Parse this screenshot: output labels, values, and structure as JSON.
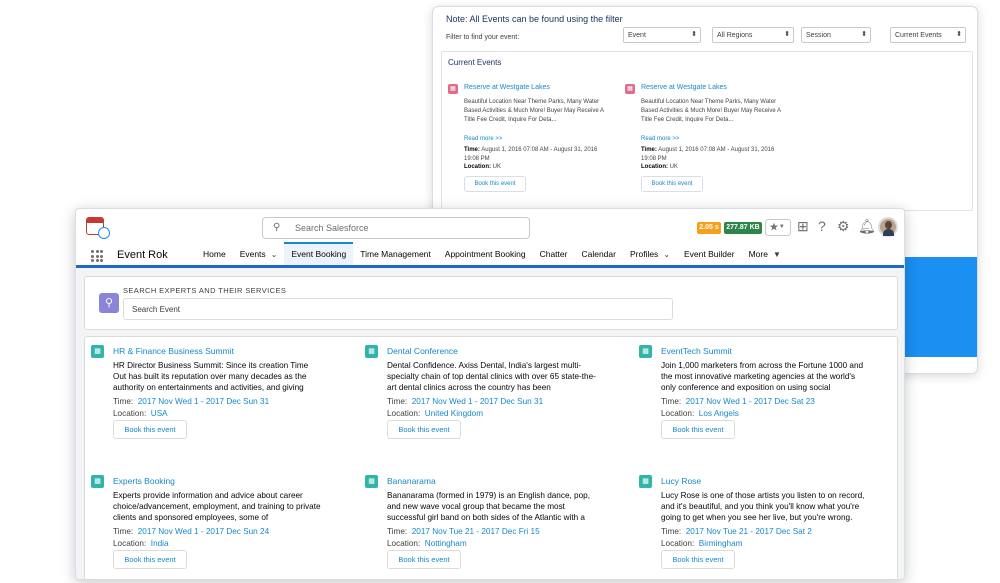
{
  "back": {
    "note": "Note: All Events can be found using the filter",
    "filter_label": "Filter to find your event:",
    "filters": [
      "Event",
      "All Regions",
      "Session",
      "Current Events"
    ],
    "panel_title": "Current Events",
    "cards": [
      {
        "title": "Reserve at Westgate Lakes",
        "desc": "Beautiful Location Near Theme Parks, Many Water Based Activities & Much More! Buyer May Receive A Title Fee Credit, Inquire For Deta...",
        "more": "Read more >>",
        "time_label": "Time:",
        "time_value": "August 1, 2016 07:08 AM - August 31, 2016 19:08 PM",
        "location_label": "Location:",
        "location_value": "UK",
        "button": "Book this event"
      },
      {
        "title": "Reserve at Westgate Lakes",
        "desc": "Beautiful Location Near Theme Parks, Many Water Based Activities & Much More! Buyer May Receive A Title Fee Credit, Inquire For Deta...",
        "more": "Read more >>",
        "time_label": "Time:",
        "time_value": "August 1, 2016 07:08 AM - August 31, 2016 19:08 PM",
        "location_label": "Location:",
        "location_value": "UK",
        "button": "Book this event"
      }
    ]
  },
  "header": {
    "search_placeholder": "Search Salesforce",
    "badge_time": "2.05 s",
    "badge_size": "277.87 KB"
  },
  "nav": {
    "app_name": "Event Rok",
    "items": [
      {
        "label": "Home",
        "dropdown": false
      },
      {
        "label": "Events",
        "dropdown": true
      },
      {
        "label": "Event Booking",
        "dropdown": false,
        "active": true
      },
      {
        "label": "Time Management",
        "dropdown": false
      },
      {
        "label": "Appointment Booking",
        "dropdown": false
      },
      {
        "label": "Chatter",
        "dropdown": false
      },
      {
        "label": "Calendar",
        "dropdown": false
      },
      {
        "label": "Profiles",
        "dropdown": true
      },
      {
        "label": "Event Builder",
        "dropdown": false
      },
      {
        "label": "More",
        "dropdown": true
      }
    ]
  },
  "search": {
    "heading": "SEARCH EXPERTS AND THEIR SERVICES",
    "placeholder": "Search Event"
  },
  "events": [
    {
      "title": "HR & Finance Business Summit",
      "desc": "HR Director Business Summit: Since its creation Time Out has built its reputation over many decades as the authority on entertainments and activities, and giving",
      "time_label": "Time:",
      "time_value": "2017 Nov Wed 1 - 2017 Dec Sun 31",
      "location_label": "Location:",
      "location_value": "USA",
      "button": "Book this event"
    },
    {
      "title": "Dental Conference",
      "desc": "Dental Confidence. Axiss Dental, India's largest multi-specialty chain of top dental clinics with over 65 state-the-art dental clinics across the country has been",
      "time_label": "Time:",
      "time_value": "2017 Nov Wed 1 - 2017 Dec Sun 31",
      "location_label": "Location:",
      "location_value": "United Kingdom",
      "button": "Book this event"
    },
    {
      "title": "EventTech Summit",
      "desc": "Join 1,000 marketers from across the Fortune 1000 and the most innovative marketing agencies at the world's only conference and exposition on using social",
      "time_label": "Time:",
      "time_value": "2017 Nov Wed 1 - 2017 Dec Sat 23",
      "location_label": "Location:",
      "location_value": "Los Angels",
      "button": "Book this event"
    },
    {
      "title": "Experts Booking",
      "desc": "Experts provide information and advice about career choice/advancement, employment, and training to private clients and sponsored employees, some of",
      "time_label": "Time:",
      "time_value": "2017 Nov Wed 1 - 2017 Dec Sun 24",
      "location_label": "Location:",
      "location_value": "India",
      "button": "Book this event"
    },
    {
      "title": "Bananarama",
      "desc": "Bananarama (formed in 1979) is an English dance, pop, and new wave vocal group that became the most successful girl band on both sides of the Atlantic with a",
      "time_label": "Time:",
      "time_value": "2017 Nov Tue 21 - 2017 Dec Fri 15",
      "location_label": "Location:",
      "location_value": "Nottingham",
      "button": "Book this event"
    },
    {
      "title": "Lucy Rose",
      "desc": "Lucy Rose is one of those artists you listen to on record, and it's beautiful, and you think you'll know what you're going to get when you see her live, but you're wrong.",
      "time_label": "Time:",
      "time_value": "2017 Nov Tue 21 - 2017 Dec Sat 2",
      "location_label": "Location:",
      "location_value": "Birmingham",
      "button": "Book this event"
    }
  ]
}
